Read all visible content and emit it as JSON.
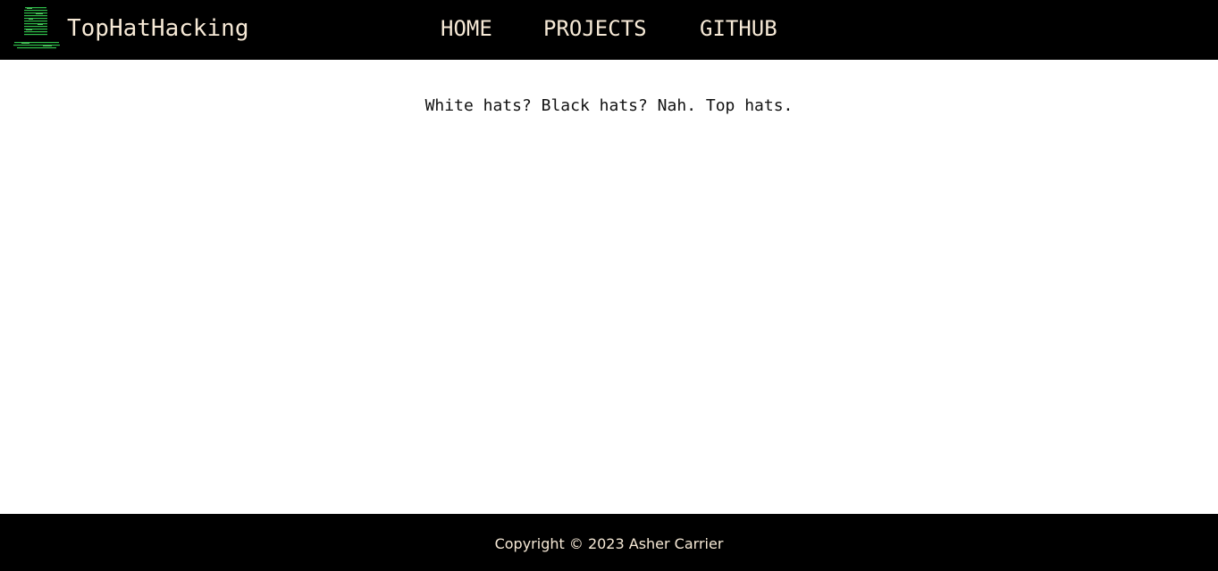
{
  "navbar": {
    "logo_icon": "matrix-top-hat-logo-icon",
    "brand": "TopHatHacking",
    "links": [
      {
        "label": "HOME"
      },
      {
        "label": "PROJECTS"
      },
      {
        "label": "GITHUB"
      }
    ]
  },
  "main": {
    "tagline": "White hats? Black hats? Nah. Top hats."
  },
  "footer": {
    "copyright": "Copyright © 2023 Asher Carrier"
  },
  "colors": {
    "bar_background": "#000000",
    "bar_text": "#f6e9d6",
    "page_background": "#ffffff",
    "logo_green": "#39d353"
  }
}
